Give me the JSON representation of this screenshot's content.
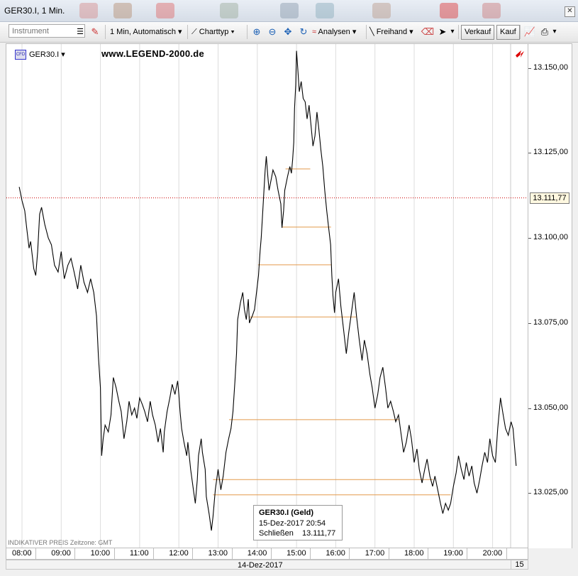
{
  "window": {
    "title": "GER30.I, 1 Min."
  },
  "toolbar": {
    "instrument_placeholder": "Instrument",
    "interval_label": "1 Min,",
    "scale_label": "Automatisch",
    "charttype_label": "Charttyp",
    "analysen_label": "Analysen",
    "freihand_label": "Freihand",
    "verkauf_label": "Verkauf",
    "kauf_label": "Kauf"
  },
  "chart": {
    "instrument_label": "GER30.I",
    "cfd_badge": "CFD",
    "watermark": "www.LEGEND-2000.de",
    "footnote": "INDIKATIVER PREIS   Zeitzone: GMT",
    "current_price_label": "13.111,77",
    "tooltip": {
      "title": "GER30.I (Geld)",
      "datetime": "15-Dez-2017 20:54",
      "close_label": "Schließen",
      "close_value": "13.111,77"
    },
    "date_label": "14-Dez-2017",
    "next_day_label": "15"
  },
  "colors": {
    "price_line": "#000000",
    "level_line": "#e39a4c",
    "current_price_line": "#cc0000"
  },
  "chart_data": {
    "type": "line",
    "xlabels": [
      "08:00",
      "09:00",
      "10:00",
      "11:00",
      "12:00",
      "13:00",
      "14:00",
      "15:00",
      "16:00",
      "17:00",
      "18:00",
      "19:00",
      "20:00"
    ],
    "ytick_labels": [
      "13.150,00",
      "13.125,00",
      "13.100,00",
      "13.075,00",
      "13.050,00",
      "13.025,00"
    ],
    "ylim": [
      13009,
      13157
    ],
    "current_price": 13111.77,
    "series": [
      {
        "values": [
          [
            7.93,
            13115
          ],
          [
            8.0,
            13111
          ],
          [
            8.07,
            13108
          ],
          [
            8.12,
            13103
          ],
          [
            8.18,
            13097
          ],
          [
            8.22,
            13099
          ],
          [
            8.3,
            13091
          ],
          [
            8.35,
            13089
          ],
          [
            8.4,
            13096
          ],
          [
            8.45,
            13107
          ],
          [
            8.5,
            13109
          ],
          [
            8.58,
            13104
          ],
          [
            8.67,
            13100
          ],
          [
            8.75,
            13098
          ],
          [
            8.83,
            13092
          ],
          [
            8.92,
            13090
          ],
          [
            9.0,
            13096
          ],
          [
            9.08,
            13088
          ],
          [
            9.17,
            13092
          ],
          [
            9.25,
            13094
          ],
          [
            9.33,
            13090
          ],
          [
            9.42,
            13085
          ],
          [
            9.5,
            13092
          ],
          [
            9.58,
            13087
          ],
          [
            9.67,
            13084
          ],
          [
            9.75,
            13088
          ],
          [
            9.83,
            13084
          ],
          [
            9.9,
            13077
          ],
          [
            9.95,
            13065
          ],
          [
            10.0,
            13056
          ],
          [
            10.03,
            13036
          ],
          [
            10.07,
            13041
          ],
          [
            10.12,
            13045
          ],
          [
            10.2,
            13043
          ],
          [
            10.27,
            13048
          ],
          [
            10.33,
            13059
          ],
          [
            10.4,
            13056
          ],
          [
            10.47,
            13052
          ],
          [
            10.53,
            13049
          ],
          [
            10.6,
            13041
          ],
          [
            10.67,
            13046
          ],
          [
            10.73,
            13052
          ],
          [
            10.8,
            13048
          ],
          [
            10.87,
            13050
          ],
          [
            10.93,
            13047
          ],
          [
            11.0,
            13053
          ],
          [
            11.07,
            13051
          ],
          [
            11.13,
            13049
          ],
          [
            11.2,
            13046
          ],
          [
            11.27,
            13052
          ],
          [
            11.33,
            13048
          ],
          [
            11.4,
            13045
          ],
          [
            11.47,
            13040
          ],
          [
            11.53,
            13044
          ],
          [
            11.6,
            13037
          ],
          [
            11.63,
            13043
          ],
          [
            11.7,
            13049
          ],
          [
            11.77,
            13053
          ],
          [
            11.83,
            13057
          ],
          [
            11.9,
            13054
          ],
          [
            11.97,
            13058
          ],
          [
            12.0,
            13054
          ],
          [
            12.03,
            13049
          ],
          [
            12.07,
            13044
          ],
          [
            12.13,
            13040
          ],
          [
            12.2,
            13036
          ],
          [
            12.23,
            13040
          ],
          [
            12.3,
            13032
          ],
          [
            12.37,
            13026
          ],
          [
            12.42,
            13022
          ],
          [
            12.47,
            13029
          ],
          [
            12.5,
            13036
          ],
          [
            12.57,
            13041
          ],
          [
            12.6,
            13037
          ],
          [
            12.67,
            13032
          ],
          [
            12.7,
            13024
          ],
          [
            12.77,
            13019
          ],
          [
            12.83,
            13014
          ],
          [
            12.87,
            13018
          ],
          [
            12.93,
            13026
          ],
          [
            13.0,
            13032
          ],
          [
            13.07,
            13026
          ],
          [
            13.13,
            13030
          ],
          [
            13.2,
            13037
          ],
          [
            13.27,
            13041
          ],
          [
            13.33,
            13044
          ],
          [
            13.38,
            13049
          ],
          [
            13.43,
            13058
          ],
          [
            13.47,
            13066
          ],
          [
            13.5,
            13076
          ],
          [
            13.57,
            13081
          ],
          [
            13.63,
            13084
          ],
          [
            13.67,
            13079
          ],
          [
            13.72,
            13076
          ],
          [
            13.77,
            13082
          ],
          [
            13.8,
            13075
          ],
          [
            13.83,
            13076
          ],
          [
            13.87,
            13077
          ],
          [
            13.93,
            13079
          ],
          [
            13.98,
            13084
          ],
          [
            14.03,
            13089
          ],
          [
            14.07,
            13096
          ],
          [
            14.1,
            13100
          ],
          [
            14.13,
            13106
          ],
          [
            14.17,
            13114
          ],
          [
            14.2,
            13120
          ],
          [
            14.23,
            13124
          ],
          [
            14.27,
            13118
          ],
          [
            14.3,
            13114
          ],
          [
            14.35,
            13117
          ],
          [
            14.4,
            13120
          ],
          [
            14.47,
            13118
          ],
          [
            14.53,
            13114
          ],
          [
            14.6,
            13110
          ],
          [
            14.63,
            13103
          ],
          [
            14.67,
            13108
          ],
          [
            14.7,
            13114
          ],
          [
            14.77,
            13118
          ],
          [
            14.83,
            13121
          ],
          [
            14.87,
            13119
          ],
          [
            14.9,
            13123
          ],
          [
            14.93,
            13128
          ],
          [
            14.95,
            13138
          ],
          [
            14.98,
            13145
          ],
          [
            15.0,
            13155
          ],
          [
            15.03,
            13150
          ],
          [
            15.07,
            13143
          ],
          [
            15.12,
            13146
          ],
          [
            15.17,
            13141
          ],
          [
            15.22,
            13140
          ],
          [
            15.27,
            13135
          ],
          [
            15.32,
            13139
          ],
          [
            15.37,
            13133
          ],
          [
            15.42,
            13127
          ],
          [
            15.47,
            13130
          ],
          [
            15.52,
            13137
          ],
          [
            15.57,
            13132
          ],
          [
            15.62,
            13126
          ],
          [
            15.67,
            13121
          ],
          [
            15.72,
            13114
          ],
          [
            15.77,
            13108
          ],
          [
            15.82,
            13103
          ],
          [
            15.87,
            13098
          ],
          [
            15.9,
            13089
          ],
          [
            15.93,
            13083
          ],
          [
            15.97,
            13078
          ],
          [
            16.0,
            13084
          ],
          [
            16.07,
            13088
          ],
          [
            16.13,
            13080
          ],
          [
            16.2,
            13073
          ],
          [
            16.27,
            13066
          ],
          [
            16.33,
            13072
          ],
          [
            16.4,
            13078
          ],
          [
            16.47,
            13084
          ],
          [
            16.53,
            13077
          ],
          [
            16.6,
            13070
          ],
          [
            16.67,
            13064
          ],
          [
            16.73,
            13070
          ],
          [
            16.8,
            13066
          ],
          [
            16.87,
            13060
          ],
          [
            16.93,
            13056
          ],
          [
            17.0,
            13050
          ],
          [
            17.07,
            13054
          ],
          [
            17.13,
            13059
          ],
          [
            17.2,
            13062
          ],
          [
            17.27,
            13056
          ],
          [
            17.33,
            13050
          ],
          [
            17.4,
            13052
          ],
          [
            17.47,
            13049
          ],
          [
            17.53,
            13046
          ],
          [
            17.6,
            13048
          ],
          [
            17.67,
            13042
          ],
          [
            17.73,
            13037
          ],
          [
            17.8,
            13040
          ],
          [
            17.87,
            13045
          ],
          [
            17.93,
            13041
          ],
          [
            18.0,
            13034
          ],
          [
            18.07,
            13038
          ],
          [
            18.13,
            13032
          ],
          [
            18.2,
            13028
          ],
          [
            18.27,
            13032
          ],
          [
            18.33,
            13035
          ],
          [
            18.4,
            13030
          ],
          [
            18.47,
            13027
          ],
          [
            18.53,
            13030
          ],
          [
            18.6,
            13026
          ],
          [
            18.67,
            13022
          ],
          [
            18.73,
            13019
          ],
          [
            18.8,
            13022
          ],
          [
            18.87,
            13020
          ],
          [
            18.93,
            13022
          ],
          [
            19.0,
            13027
          ],
          [
            19.07,
            13031
          ],
          [
            19.13,
            13036
          ],
          [
            19.2,
            13032
          ],
          [
            19.27,
            13029
          ],
          [
            19.33,
            13034
          ],
          [
            19.4,
            13030
          ],
          [
            19.47,
            13033
          ],
          [
            19.53,
            13028
          ],
          [
            19.6,
            13025
          ],
          [
            19.67,
            13029
          ],
          [
            19.73,
            13033
          ],
          [
            19.8,
            13037
          ],
          [
            19.87,
            13034
          ],
          [
            19.93,
            13041
          ],
          [
            20.0,
            13036
          ],
          [
            20.07,
            13034
          ],
          [
            20.13,
            13044
          ],
          [
            20.2,
            13053
          ],
          [
            20.27,
            13048
          ],
          [
            20.33,
            13044
          ],
          [
            20.4,
            13042
          ],
          [
            20.47,
            13046
          ],
          [
            20.52,
            13044
          ],
          [
            20.6,
            13033
          ]
        ]
      }
    ],
    "levels": [
      {
        "y": 13120.3,
        "x1": 14.72,
        "x2": 15.35
      },
      {
        "y": 13103.2,
        "x1": 14.62,
        "x2": 15.88
      },
      {
        "y": 13092.1,
        "x1": 14.02,
        "x2": 15.88
      },
      {
        "y": 13076.8,
        "x1": 13.8,
        "x2": 16.52
      },
      {
        "y": 13046.6,
        "x1": 13.28,
        "x2": 17.62
      },
      {
        "y": 13029.0,
        "x1": 12.87,
        "x2": 18.48
      },
      {
        "y": 13024.5,
        "x1": 12.87,
        "x2": 18.93
      }
    ]
  }
}
